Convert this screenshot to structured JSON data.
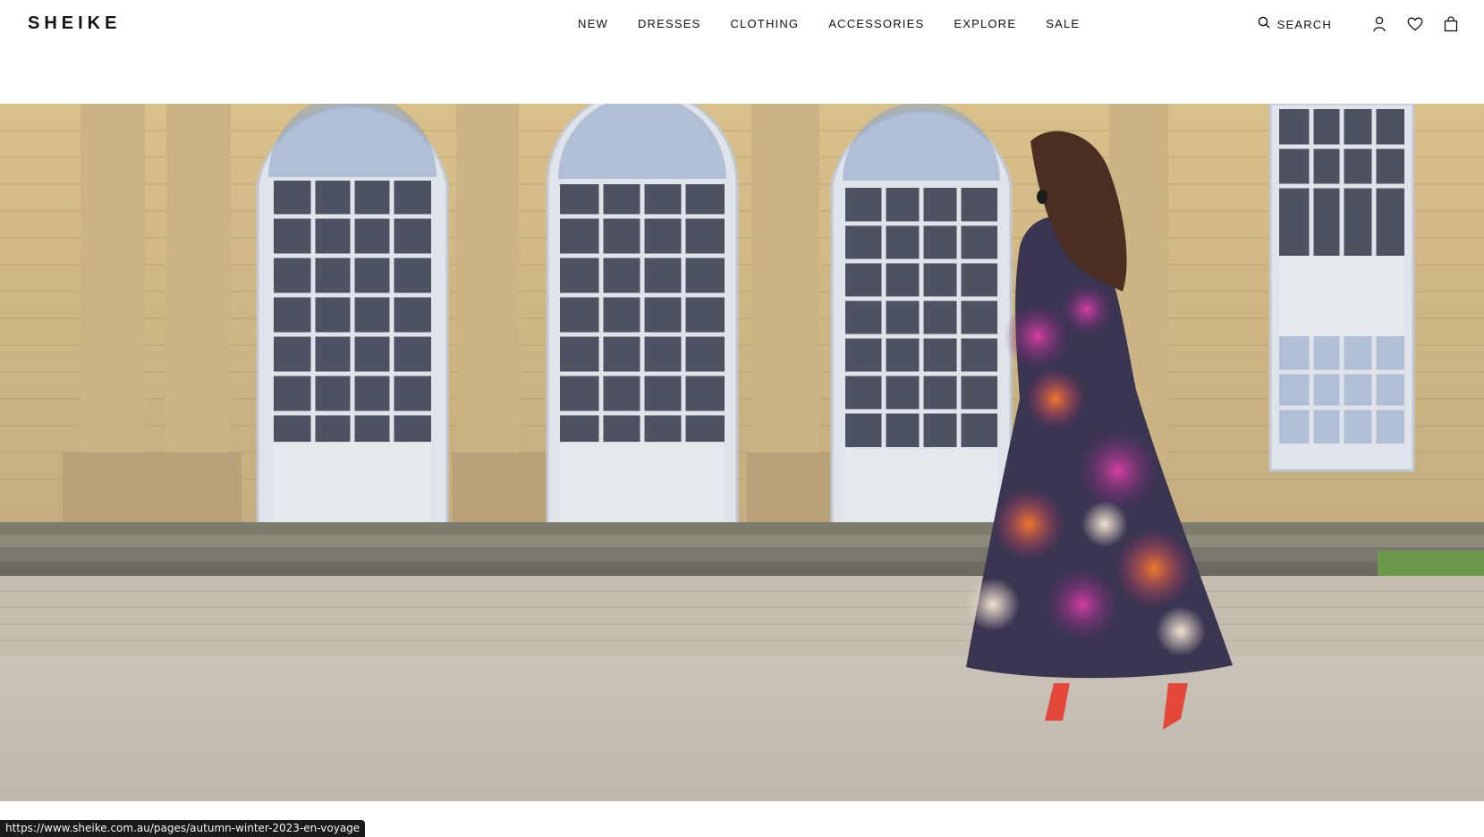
{
  "brand": {
    "name": "SHEIKE"
  },
  "nav": {
    "items": [
      {
        "label": "NEW"
      },
      {
        "label": "DRESSES"
      },
      {
        "label": "CLOTHING"
      },
      {
        "label": "ACCESSORIES"
      },
      {
        "label": "EXPLORE"
      },
      {
        "label": "SALE"
      }
    ]
  },
  "tools": {
    "search_label": "SEARCH",
    "icons": [
      "search-icon",
      "account-icon",
      "wishlist-heart-icon",
      "shopping-bag-icon"
    ]
  },
  "hero": {
    "image": "campaign photo: woman in floral maxi dress walking toward a palace facade with arched windows"
  },
  "status_bar": {
    "url": "https://www.sheike.com.au/pages/autumn-winter-2023-en-voyage"
  },
  "colors": {
    "text": "#111111",
    "background": "#ffffff",
    "status_bg": "#1a1a1a"
  }
}
